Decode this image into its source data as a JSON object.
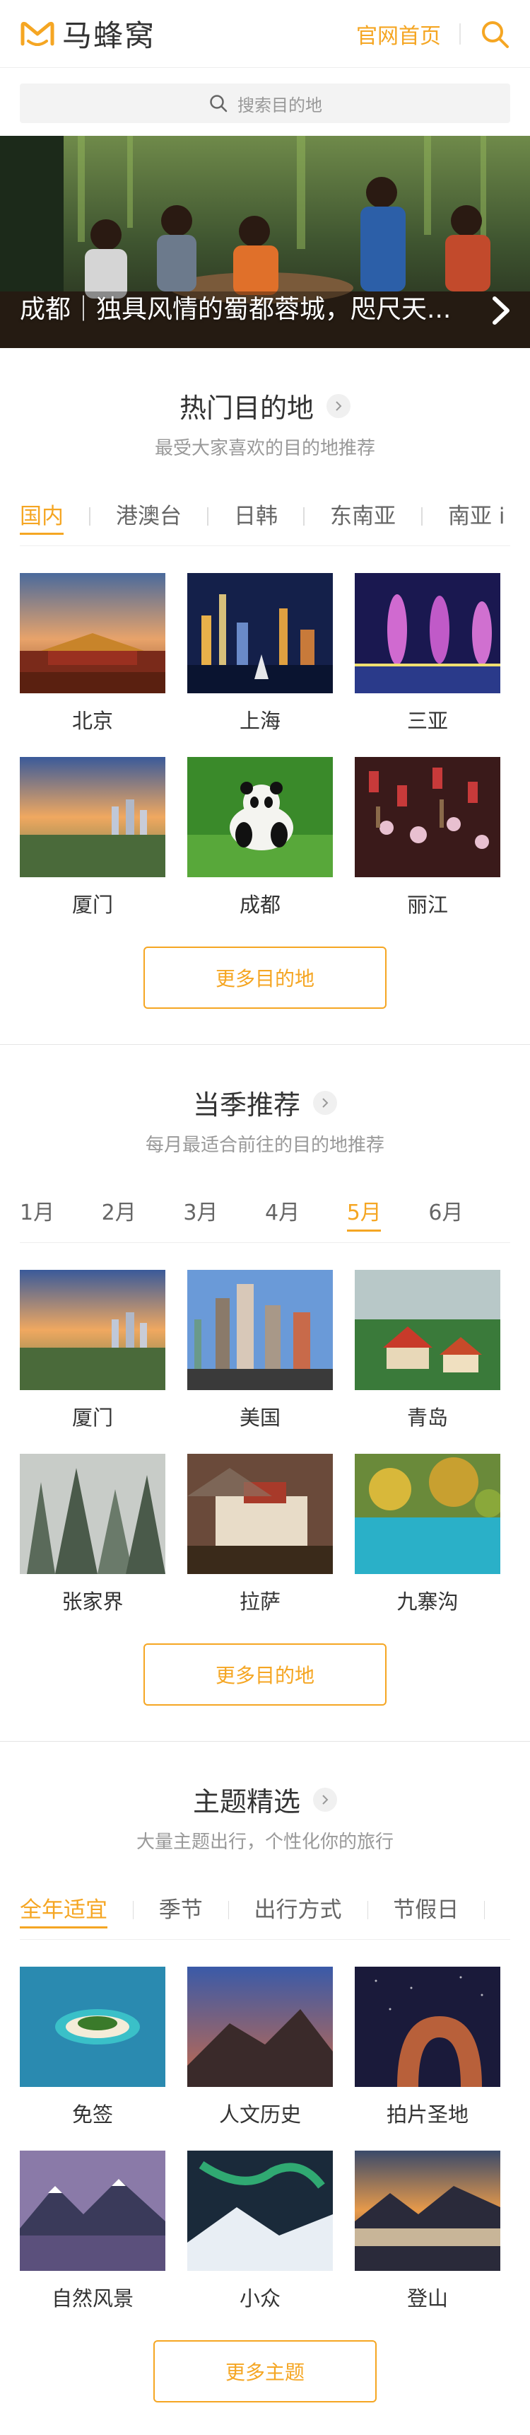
{
  "header": {
    "logo_text": "马蜂窝",
    "home_link": "官网首页"
  },
  "search": {
    "placeholder": "搜索目的地"
  },
  "banner": {
    "caption": "成都｜独具风情的蜀都蓉城，咫尺天..."
  },
  "hot": {
    "title": "热门目的地",
    "subtitle": "最受大家喜欢的目的地推荐",
    "tabs": [
      "国内",
      "港澳台",
      "日韩",
      "东南亚",
      "南亚 i"
    ],
    "active_tab": 0,
    "cards": [
      "北京",
      "上海",
      "三亚",
      "厦门",
      "成都",
      "丽江"
    ],
    "more": "更多目的地"
  },
  "season": {
    "title": "当季推荐",
    "subtitle": "每月最适合前往的目的地推荐",
    "months": [
      "1月",
      "2月",
      "3月",
      "4月",
      "5月",
      "6月"
    ],
    "active_month": 4,
    "cards": [
      "厦门",
      "美国",
      "青岛",
      "张家界",
      "拉萨",
      "九寨沟"
    ],
    "more": "更多目的地"
  },
  "theme": {
    "title": "主题精选",
    "subtitle": "大量主题出行，个性化你的旅行",
    "tabs": [
      "全年适宜",
      "季节",
      "出行方式",
      "节假日"
    ],
    "active_tab": 0,
    "cards": [
      "免签",
      "人文历史",
      "拍片圣地",
      "自然风景",
      "小众",
      "登山"
    ],
    "more": "更多主题"
  },
  "colors": {
    "accent": "#f5a623"
  },
  "icons": {
    "logo": "mafengwo-logo-icon",
    "search": "search-icon",
    "chevron": "chevron-right-icon"
  }
}
